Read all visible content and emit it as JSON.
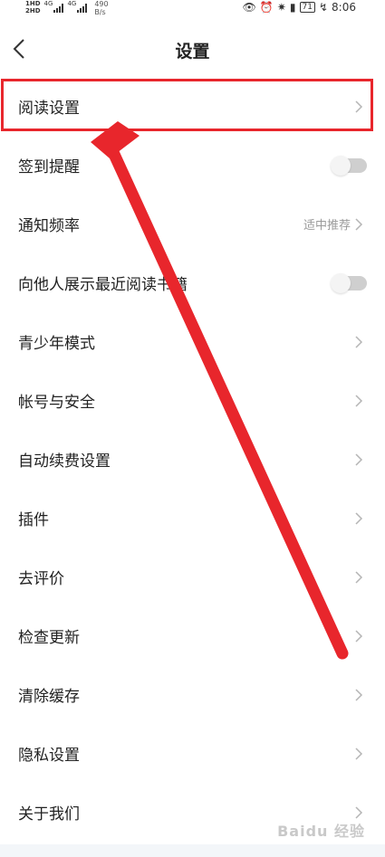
{
  "status_bar": {
    "sim1": "1HD",
    "sim2": "2HD",
    "network1": "4G",
    "network2": "4G",
    "speed_value": "490",
    "speed_unit": "B/s",
    "battery": "71",
    "time": "8:06"
  },
  "header": {
    "title": "设置"
  },
  "settings": [
    {
      "label": "阅读设置",
      "control": "chevron"
    },
    {
      "label": "签到提醒",
      "control": "toggle",
      "on": false
    },
    {
      "label": "通知频率",
      "control": "chevron",
      "value": "适中推荐"
    },
    {
      "label": "向他人展示最近阅读书籍",
      "control": "toggle",
      "on": false
    },
    {
      "label": "青少年模式",
      "control": "chevron"
    },
    {
      "label": "帐号与安全",
      "control": "chevron"
    },
    {
      "label": "自动续费设置",
      "control": "chevron"
    },
    {
      "label": "插件",
      "control": "chevron"
    },
    {
      "label": "去评价",
      "control": "chevron"
    },
    {
      "label": "检查更新",
      "control": "chevron"
    },
    {
      "label": "清除缓存",
      "control": "chevron"
    },
    {
      "label": "隐私设置",
      "control": "chevron"
    },
    {
      "label": "关于我们",
      "control": "chevron"
    }
  ],
  "annotation": {
    "color": "#e8262c"
  },
  "watermark": "Baidu 经验"
}
